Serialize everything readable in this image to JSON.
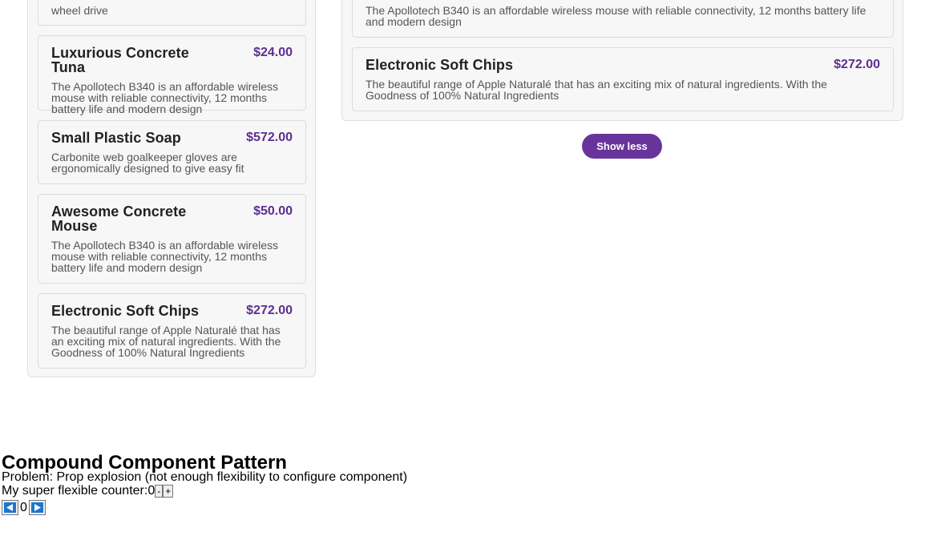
{
  "left_panel": {
    "partial_card_text": "wheel drive",
    "cards": [
      {
        "title": "Luxurious Concrete Tuna",
        "price": "$24.00",
        "description": "The Apollotech B340 is an affordable wireless mouse with reliable connectivity, 12 months battery life and modern design"
      },
      {
        "title": "Small Plastic Soap",
        "price": "$572.00",
        "description": "Carbonite web goalkeeper gloves are ergonomically designed to give easy fit"
      },
      {
        "title": "Awesome Concrete Mouse",
        "price": "$50.00",
        "description": "The Apollotech B340 is an affordable wireless mouse with reliable connectivity, 12 months battery life and modern design"
      },
      {
        "title": "Electronic Soft Chips",
        "price": "$272.00",
        "description": "The beautiful range of Apple Naturalé that has an exciting mix of natural ingredients. With the Goodness of 100% Natural Ingredients"
      }
    ]
  },
  "right_panel": {
    "partial_card_text": "The Apollotech B340 is an affordable wireless mouse with reliable connectivity, 12 months battery life and modern design",
    "cards": [
      {
        "title": "Electronic Soft Chips",
        "price": "$272.00",
        "description": "The beautiful range of Apple Naturalé that has an exciting mix of natural ingredients. With the Goodness of 100% Natural Ingredients"
      }
    ],
    "show_less_label": "Show less"
  },
  "compound": {
    "heading": "Compound Component Pattern",
    "problem": "Problem: Prop explosion (not enough flexibility to configure component)",
    "counter_label": "My super flexible counter:",
    "counter_value": "0",
    "minus_label": "-",
    "plus_label": "+",
    "counter2_value": "0",
    "prev_icon": "triangle-left-icon",
    "next_icon": "triangle-right-icon"
  },
  "colors": {
    "price": "#5e2d91",
    "button": "#68349c",
    "arrow_icon": "#1a76d2"
  }
}
